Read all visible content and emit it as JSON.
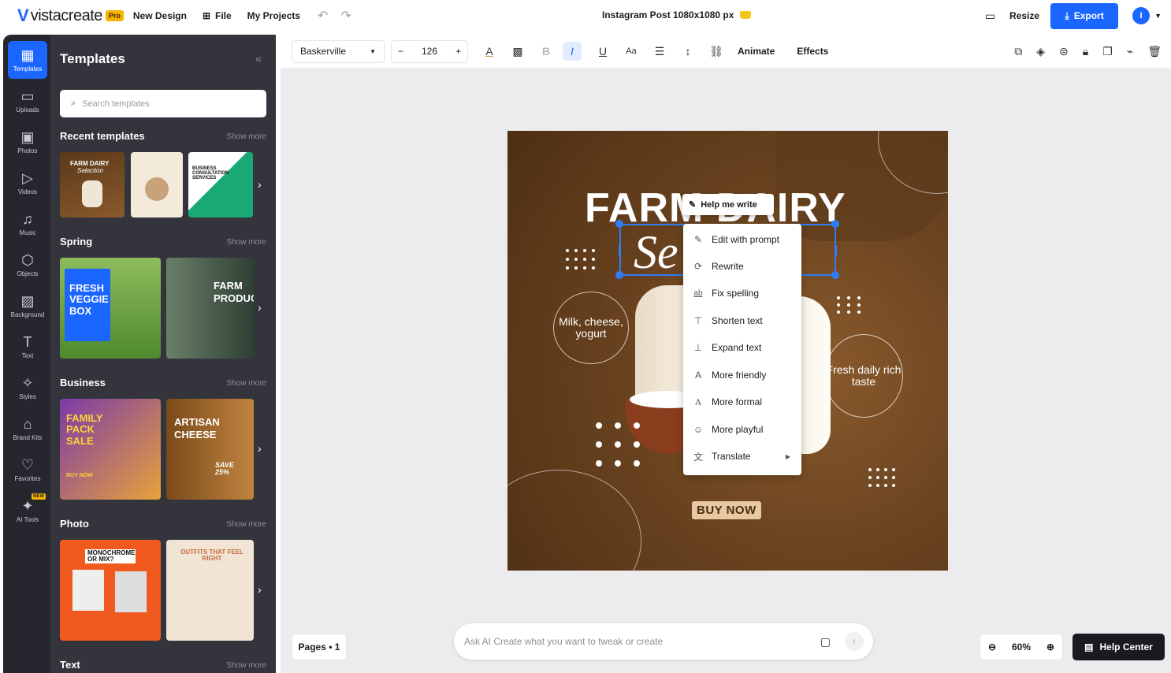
{
  "topbar": {
    "logo_text": "vistacreate",
    "pro_badge": "Pro",
    "new_design": "New Design",
    "file": "File",
    "my_projects": "My Projects",
    "doc_title": "Instagram Post 1080x1080 px",
    "resize": "Resize",
    "export": "Export",
    "avatar_letter": "I"
  },
  "rail": {
    "items": [
      {
        "label": "Templates",
        "icon": "templates-icon"
      },
      {
        "label": "Uploads",
        "icon": "folder-icon"
      },
      {
        "label": "Photos",
        "icon": "photo-icon"
      },
      {
        "label": "Videos",
        "icon": "video-icon"
      },
      {
        "label": "Music",
        "icon": "music-icon"
      },
      {
        "label": "Objects",
        "icon": "objects-icon"
      },
      {
        "label": "Background",
        "icon": "background-icon"
      },
      {
        "label": "Text",
        "icon": "text-icon"
      },
      {
        "label": "Styles",
        "icon": "sparkle-icon"
      },
      {
        "label": "Brand Kits",
        "icon": "briefcase-icon"
      },
      {
        "label": "Favorites",
        "icon": "heart-icon"
      },
      {
        "label": "AI Tools",
        "icon": "ai-sparkle-icon"
      }
    ],
    "new_badge": "NEW"
  },
  "panel": {
    "title": "Templates",
    "search_placeholder": "Search templates",
    "show_more": "Show more",
    "sections": [
      {
        "title": "Recent templates"
      },
      {
        "title": "Spring"
      },
      {
        "title": "Business"
      },
      {
        "title": "Photo"
      },
      {
        "title": "Text"
      }
    ],
    "thumb_texts": {
      "farm_dairy": "FARM DAIRY",
      "selection": "Selection",
      "business": "BUSINESS CONSULTATION SERVICES",
      "fresh_veggie": "FRESH VEGGIE BOX",
      "farm_products": "FARM PRODUCTS",
      "family_pack": "FAMILY PACK SALE",
      "buy_now": "BUY NOW",
      "artisan": "ARTISAN CHEESE",
      "save": "SAVE 25%",
      "monochrome": "MONOCHROME OR MIX?",
      "outfits": "OUTFITS THAT FEEL RIGHT"
    }
  },
  "toolbar": {
    "font": "Baskerville",
    "size": "126",
    "animate": "Animate",
    "effects": "Effects"
  },
  "canvas": {
    "title": "FARM DAIRY",
    "script": "Se          n",
    "bubble_left": "Milk, cheese, yogurt",
    "bubble_right": "Fresh daily rich taste",
    "buy_now": "BUY NOW"
  },
  "ai_menu": {
    "help_me_write": "Help me write",
    "items": [
      {
        "label": "Edit with prompt",
        "icon": "edit-prompt-icon"
      },
      {
        "label": "Rewrite",
        "icon": "rewrite-icon"
      },
      {
        "label": "Fix spelling",
        "icon": "spelling-icon"
      },
      {
        "label": "Shorten text",
        "icon": "shorten-icon"
      },
      {
        "label": "Expand text",
        "icon": "expand-icon"
      },
      {
        "label": "More friendly",
        "icon": "font-a-icon"
      },
      {
        "label": "More formal",
        "icon": "font-a-icon"
      },
      {
        "label": "More playful",
        "icon": "smile-icon"
      },
      {
        "label": "Translate",
        "icon": "translate-icon"
      }
    ]
  },
  "bottom": {
    "pages": "Pages • 1",
    "ai_placeholder": "Ask AI Create what you want to tweak or create",
    "zoom": "60%",
    "help_center": "Help Center"
  },
  "colors": {
    "accent": "#1b66ff",
    "rail_bg": "#26262e",
    "panel_bg": "#33343c",
    "canvas_bg": "#6b4420"
  }
}
